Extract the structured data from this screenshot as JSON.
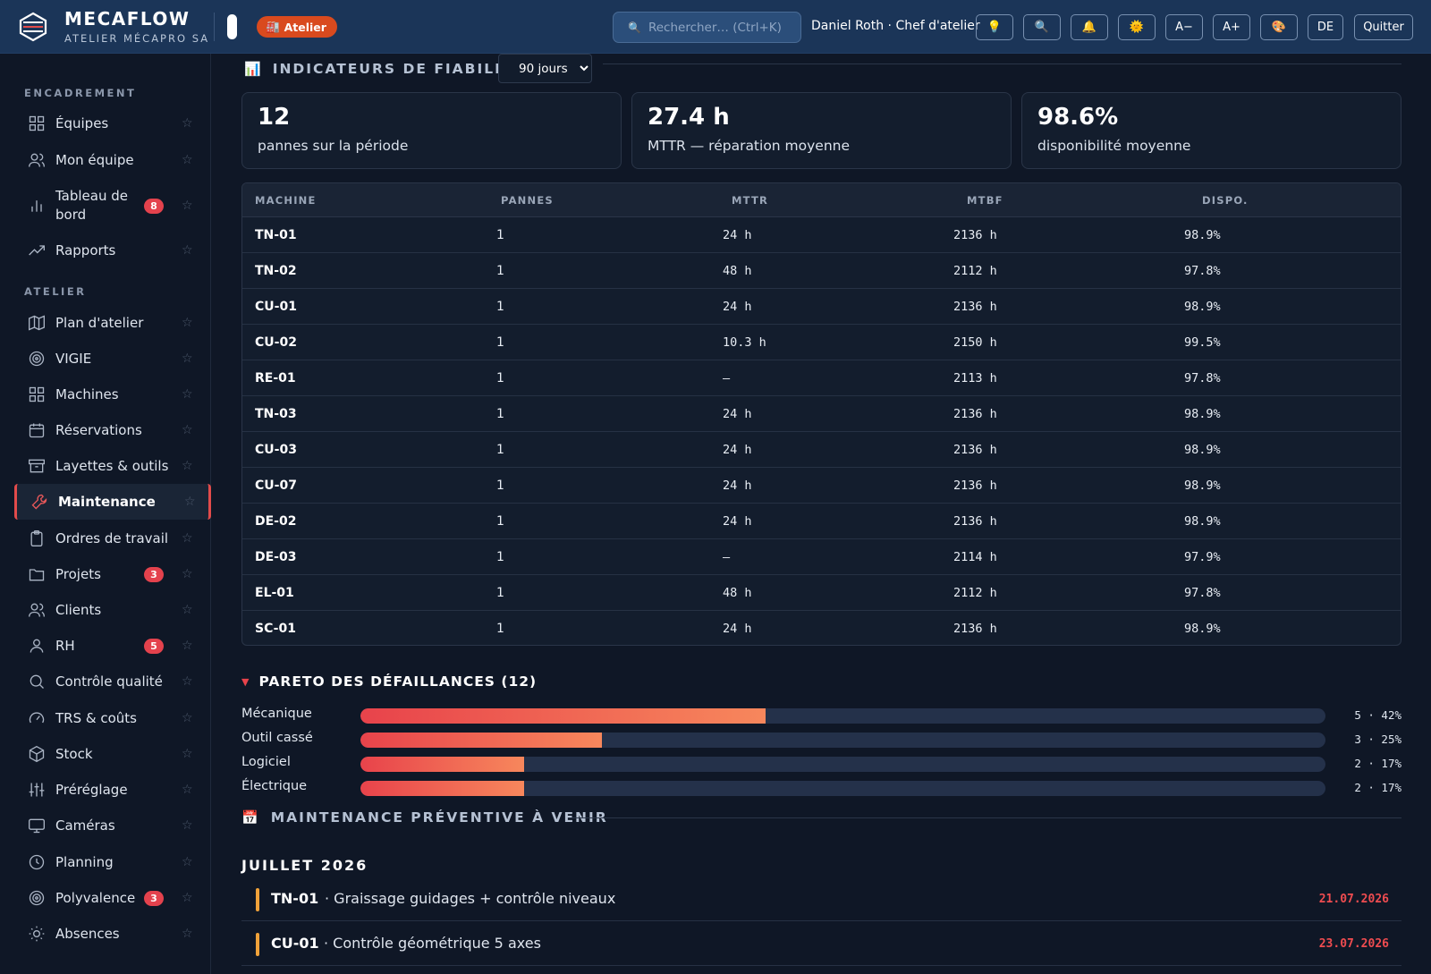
{
  "brand": {
    "name": "MECAFLOW",
    "subtitle": "ATELIER MÉCAPRO SA",
    "badge": "Atelier"
  },
  "search": {
    "placeholder": "Rechercher… (Ctrl+K)"
  },
  "user": {
    "label": "Daniel Roth · Chef d'atelier"
  },
  "toolbar": {
    "font_smaller": "A−",
    "font_larger": "A+",
    "language": "DE",
    "quit": "Quitter"
  },
  "sidebar": {
    "section_1": "ENCADREMENT",
    "section_2": "ATELIER",
    "items": [
      {
        "label": "Équipes",
        "icon": "grid-icon",
        "badge": ""
      },
      {
        "label": "Mon équipe",
        "icon": "users-icon",
        "badge": ""
      },
      {
        "label": "Tableau de bord",
        "icon": "bar-chart-icon",
        "badge": "8"
      },
      {
        "label": "Rapports",
        "icon": "trend-icon",
        "badge": ""
      },
      {
        "label": "Plan d'atelier",
        "icon": "map-icon",
        "badge": ""
      },
      {
        "label": "VIGIE",
        "icon": "target-icon",
        "badge": ""
      },
      {
        "label": "Machines",
        "icon": "grid-icon",
        "badge": ""
      },
      {
        "label": "Réservations",
        "icon": "calendar-icon",
        "badge": ""
      },
      {
        "label": "Layettes & outils",
        "icon": "archive-icon",
        "badge": ""
      },
      {
        "label": "Maintenance",
        "icon": "wrench-icon",
        "badge": "",
        "active": true
      },
      {
        "label": "Ordres de travail",
        "icon": "clipboard-icon",
        "badge": ""
      },
      {
        "label": "Projets",
        "icon": "folder-icon",
        "badge": "3"
      },
      {
        "label": "Clients",
        "icon": "users-icon",
        "badge": ""
      },
      {
        "label": "RH",
        "icon": "user-icon",
        "badge": "5"
      },
      {
        "label": "Contrôle qualité",
        "icon": "search-icon",
        "badge": ""
      },
      {
        "label": "TRS & coûts",
        "icon": "gauge-icon",
        "badge": ""
      },
      {
        "label": "Stock",
        "icon": "box-icon",
        "badge": ""
      },
      {
        "label": "Préréglage",
        "icon": "sliders-icon",
        "badge": ""
      },
      {
        "label": "Caméras",
        "icon": "monitor-icon",
        "badge": ""
      },
      {
        "label": "Planning",
        "icon": "clock-icon",
        "badge": ""
      },
      {
        "label": "Polyvalence",
        "icon": "target-icon",
        "badge": "3"
      },
      {
        "label": "Absences",
        "icon": "sun-icon",
        "badge": ""
      }
    ]
  },
  "reliability": {
    "title": "INDICATEURS DE FIABILITÉ",
    "period": "90 jours",
    "period_options": [
      "90 jours"
    ],
    "kpis": [
      {
        "value": "12",
        "caption": "pannes sur la période"
      },
      {
        "value": "27.4 h",
        "caption": "MTTR — réparation moyenne"
      },
      {
        "value": "98.6%",
        "caption": "disponibilité moyenne"
      }
    ],
    "columns": [
      "MACHINE",
      "PANNES",
      "MTTR",
      "MTBF",
      "DISPO."
    ],
    "rows": [
      {
        "machine": "TN-01",
        "pannes": "1",
        "mttr": "24 h",
        "mtbf": "2136 h",
        "dispo": "98.9%"
      },
      {
        "machine": "TN-02",
        "pannes": "1",
        "mttr": "48 h",
        "mtbf": "2112 h",
        "dispo": "97.8%"
      },
      {
        "machine": "CU-01",
        "pannes": "1",
        "mttr": "24 h",
        "mtbf": "2136 h",
        "dispo": "98.9%"
      },
      {
        "machine": "CU-02",
        "pannes": "1",
        "mttr": "10.3 h",
        "mtbf": "2150 h",
        "dispo": "99.5%"
      },
      {
        "machine": "RE-01",
        "pannes": "1",
        "mttr": "—",
        "mtbf": "2113 h",
        "dispo": "97.8%"
      },
      {
        "machine": "TN-03",
        "pannes": "1",
        "mttr": "24 h",
        "mtbf": "2136 h",
        "dispo": "98.9%"
      },
      {
        "machine": "CU-03",
        "pannes": "1",
        "mttr": "24 h",
        "mtbf": "2136 h",
        "dispo": "98.9%"
      },
      {
        "machine": "CU-07",
        "pannes": "1",
        "mttr": "24 h",
        "mtbf": "2136 h",
        "dispo": "98.9%"
      },
      {
        "machine": "DE-02",
        "pannes": "1",
        "mttr": "24 h",
        "mtbf": "2136 h",
        "dispo": "98.9%"
      },
      {
        "machine": "DE-03",
        "pannes": "1",
        "mttr": "—",
        "mtbf": "2114 h",
        "dispo": "97.9%"
      },
      {
        "machine": "EL-01",
        "pannes": "1",
        "mttr": "48 h",
        "mtbf": "2112 h",
        "dispo": "97.8%"
      },
      {
        "machine": "SC-01",
        "pannes": "1",
        "mttr": "24 h",
        "mtbf": "2136 h",
        "dispo": "98.9%"
      }
    ]
  },
  "pareto": {
    "title": "PARETO DES DÉFAILLANCES (12)",
    "items": [
      {
        "label": "Mécanique",
        "count": 5,
        "percent": 42,
        "display": "5 · 42%"
      },
      {
        "label": "Outil cassé",
        "count": 3,
        "percent": 25,
        "display": "3 · 25%"
      },
      {
        "label": "Logiciel",
        "count": 2,
        "percent": 17,
        "display": "2 · 17%"
      },
      {
        "label": "Électrique",
        "count": 2,
        "percent": 17,
        "display": "2 · 17%"
      }
    ]
  },
  "preventive": {
    "title": "MAINTENANCE PRÉVENTIVE À VENIR",
    "month": "JUILLET 2026",
    "items": [
      {
        "machine": "TN-01",
        "desc": "· Graissage guidages + contrôle niveaux",
        "date": "21.07.2026"
      },
      {
        "machine": "CU-01",
        "desc": "· Contrôle géométrique 5 axes",
        "date": "23.07.2026"
      }
    ]
  },
  "colors": {
    "accent": "#e24b4b",
    "topbar": "#1b3558",
    "badge": "#e4424d",
    "atelier_badge": "#d94a1e",
    "pm_marker": "#f0a23a",
    "date": "#ef4c50"
  }
}
